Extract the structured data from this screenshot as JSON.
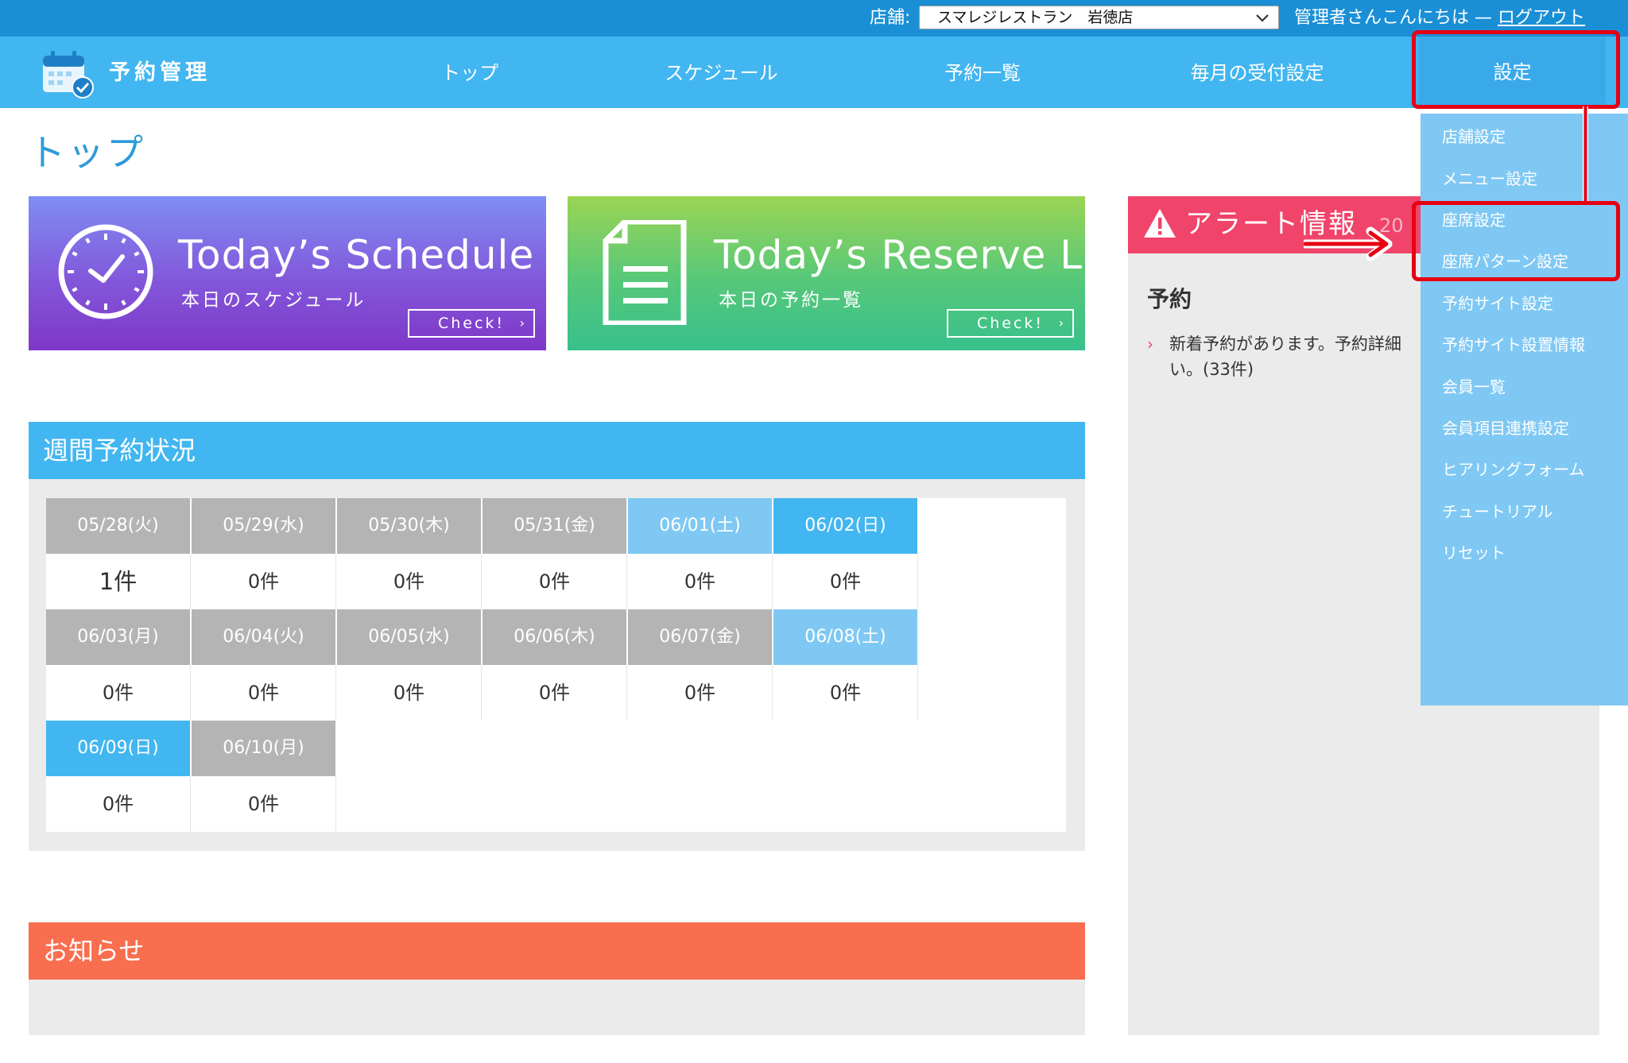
{
  "topbar": {
    "store_label": "店舗:",
    "store_selected": "スマレジレストラン　岩徳店",
    "greeting": "管理者さんこんにちは",
    "separator": " — ",
    "logout": "ログアウト"
  },
  "brand": {
    "title": "予約管理"
  },
  "nav": {
    "items": [
      {
        "label": "トップ"
      },
      {
        "label": "スケジュール"
      },
      {
        "label": "予約一覧"
      },
      {
        "label": "毎月の受付設定"
      }
    ],
    "settings": "設定"
  },
  "dropdown": {
    "items": [
      "店舗設定",
      "メニュー設定",
      "座席設定",
      "座席パターン設定",
      "予約サイト設定",
      "予約サイト設置情報",
      "会員一覧",
      "会員項目連携設定",
      "ヒアリングフォーム",
      "チュートリアル",
      "リセット"
    ]
  },
  "page": {
    "title": "トップ"
  },
  "banners": {
    "schedule": {
      "title": "Today’s Schedule",
      "subtitle": "本日のスケジュール",
      "button": "Check!"
    },
    "reserve": {
      "title": "Today’s Reserve List",
      "subtitle": "本日の予約一覧",
      "button": "Check!"
    }
  },
  "alert": {
    "title": "アラート情報",
    "year_partial": "20",
    "section": "予約",
    "message": "新着予約があります。予約詳細　い。(33件)",
    "message_line1": "新着予約があります。予約詳細",
    "message_line2": "い。(33件)"
  },
  "weekly": {
    "title": "週間予約状況",
    "days": [
      {
        "date": "05/28(火)",
        "count": "1件",
        "type": "weekday"
      },
      {
        "date": "05/29(水)",
        "count": "0件",
        "type": "weekday"
      },
      {
        "date": "05/30(木)",
        "count": "0件",
        "type": "weekday"
      },
      {
        "date": "05/31(金)",
        "count": "0件",
        "type": "weekday"
      },
      {
        "date": "06/01(土)",
        "count": "0件",
        "type": "sat"
      },
      {
        "date": "06/02(日)",
        "count": "0件",
        "type": "sun"
      },
      {
        "date": "06/03(月)",
        "count": "0件",
        "type": "weekday"
      },
      {
        "date": "06/04(火)",
        "count": "0件",
        "type": "weekday"
      },
      {
        "date": "06/05(水)",
        "count": "0件",
        "type": "weekday"
      },
      {
        "date": "06/06(木)",
        "count": "0件",
        "type": "weekday"
      },
      {
        "date": "06/07(金)",
        "count": "0件",
        "type": "weekday"
      },
      {
        "date": "06/08(土)",
        "count": "0件",
        "type": "sat"
      },
      {
        "date": "06/09(日)",
        "count": "0件",
        "type": "sun"
      },
      {
        "date": "06/10(月)",
        "count": "0件",
        "type": "weekday"
      }
    ]
  },
  "news": {
    "title": "お知らせ"
  },
  "colors": {
    "topbar": "#1a8fd6",
    "navbar": "#42b6f0",
    "dropdown": "#7fc8f3",
    "highlight": "#e60012",
    "alert": "#f0446a",
    "news": "#f96e4e",
    "weekday": "#b4b4b4",
    "saturday": "#7fc8f3",
    "sunday": "#42b6f0"
  },
  "icons": {
    "logo": "calendar-check-icon",
    "select": "chevron-down-icon",
    "schedule": "clock-icon",
    "reserve": "document-icon",
    "alert": "warning-icon",
    "annotation": "arrow-right-icon"
  }
}
